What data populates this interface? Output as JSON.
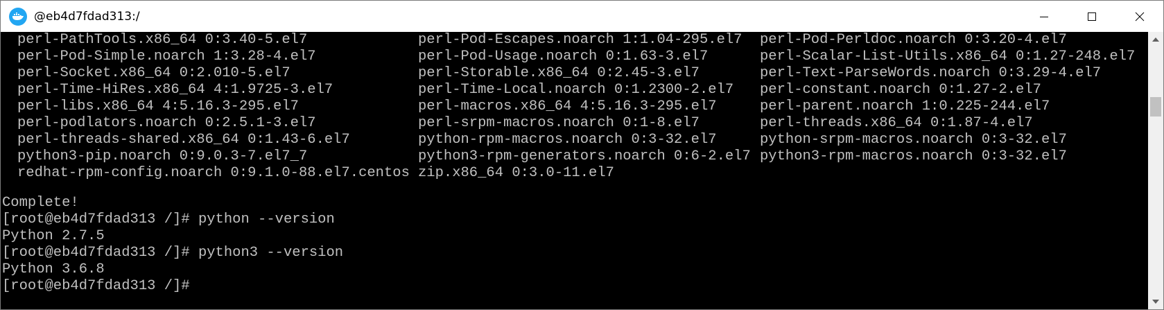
{
  "window": {
    "title": "@eb4d7fdad313:/",
    "icon": "docker-whale-icon",
    "accent": "#22a6f2"
  },
  "controls": {
    "minimize_icon": "minimize-icon",
    "maximize_icon": "maximize-icon",
    "close_icon": "close-icon"
  },
  "terminal": {
    "background": "#000000",
    "foreground": "#c0c0c0",
    "packages": [
      [
        "perl-PathTools.x86_64 0:3.40-5.el7",
        "perl-Pod-Escapes.noarch 1:1.04-295.el7",
        "perl-Pod-Perldoc.noarch 0:3.20-4.el7"
      ],
      [
        "perl-Pod-Simple.noarch 1:3.28-4.el7",
        "perl-Pod-Usage.noarch 0:1.63-3.el7",
        "perl-Scalar-List-Utils.x86_64 0:1.27-248.el7"
      ],
      [
        "perl-Socket.x86_64 0:2.010-5.el7",
        "perl-Storable.x86_64 0:2.45-3.el7",
        "perl-Text-ParseWords.noarch 0:3.29-4.el7"
      ],
      [
        "perl-Time-HiRes.x86_64 4:1.9725-3.el7",
        "perl-Time-Local.noarch 0:1.2300-2.el7",
        "perl-constant.noarch 0:1.27-2.el7"
      ],
      [
        "perl-libs.x86_64 4:5.16.3-295.el7",
        "perl-macros.x86_64 4:5.16.3-295.el7",
        "perl-parent.noarch 1:0.225-244.el7"
      ],
      [
        "perl-podlators.noarch 0:2.5.1-3.el7",
        "perl-srpm-macros.noarch 0:1-8.el7",
        "perl-threads.x86_64 0:1.87-4.el7"
      ],
      [
        "perl-threads-shared.x86_64 0:1.43-6.el7",
        "python-rpm-macros.noarch 0:3-32.el7",
        "python-srpm-macros.noarch 0:3-32.el7"
      ],
      [
        "python3-pip.noarch 0:9.0.3-7.el7_7",
        "python3-rpm-generators.noarch 0:6-2.el7",
        "python3-rpm-macros.noarch 0:3-32.el7"
      ],
      [
        "redhat-rpm-config.noarch 0:9.1.0-88.el7.centos",
        "zip.x86_64 0:3.0-11.el7",
        ""
      ]
    ],
    "lines": [
      "Complete!",
      "[root@eb4d7fdad313 /]# python --version",
      "Python 2.7.5",
      "[root@eb4d7fdad313 /]# python3 --version",
      "Python 3.6.8",
      "[root@eb4d7fdad313 /]#"
    ]
  },
  "scrollbar": {
    "up_icon": "scroll-up-icon",
    "down_icon": "scroll-down-icon",
    "thumb_position": 0.22
  }
}
